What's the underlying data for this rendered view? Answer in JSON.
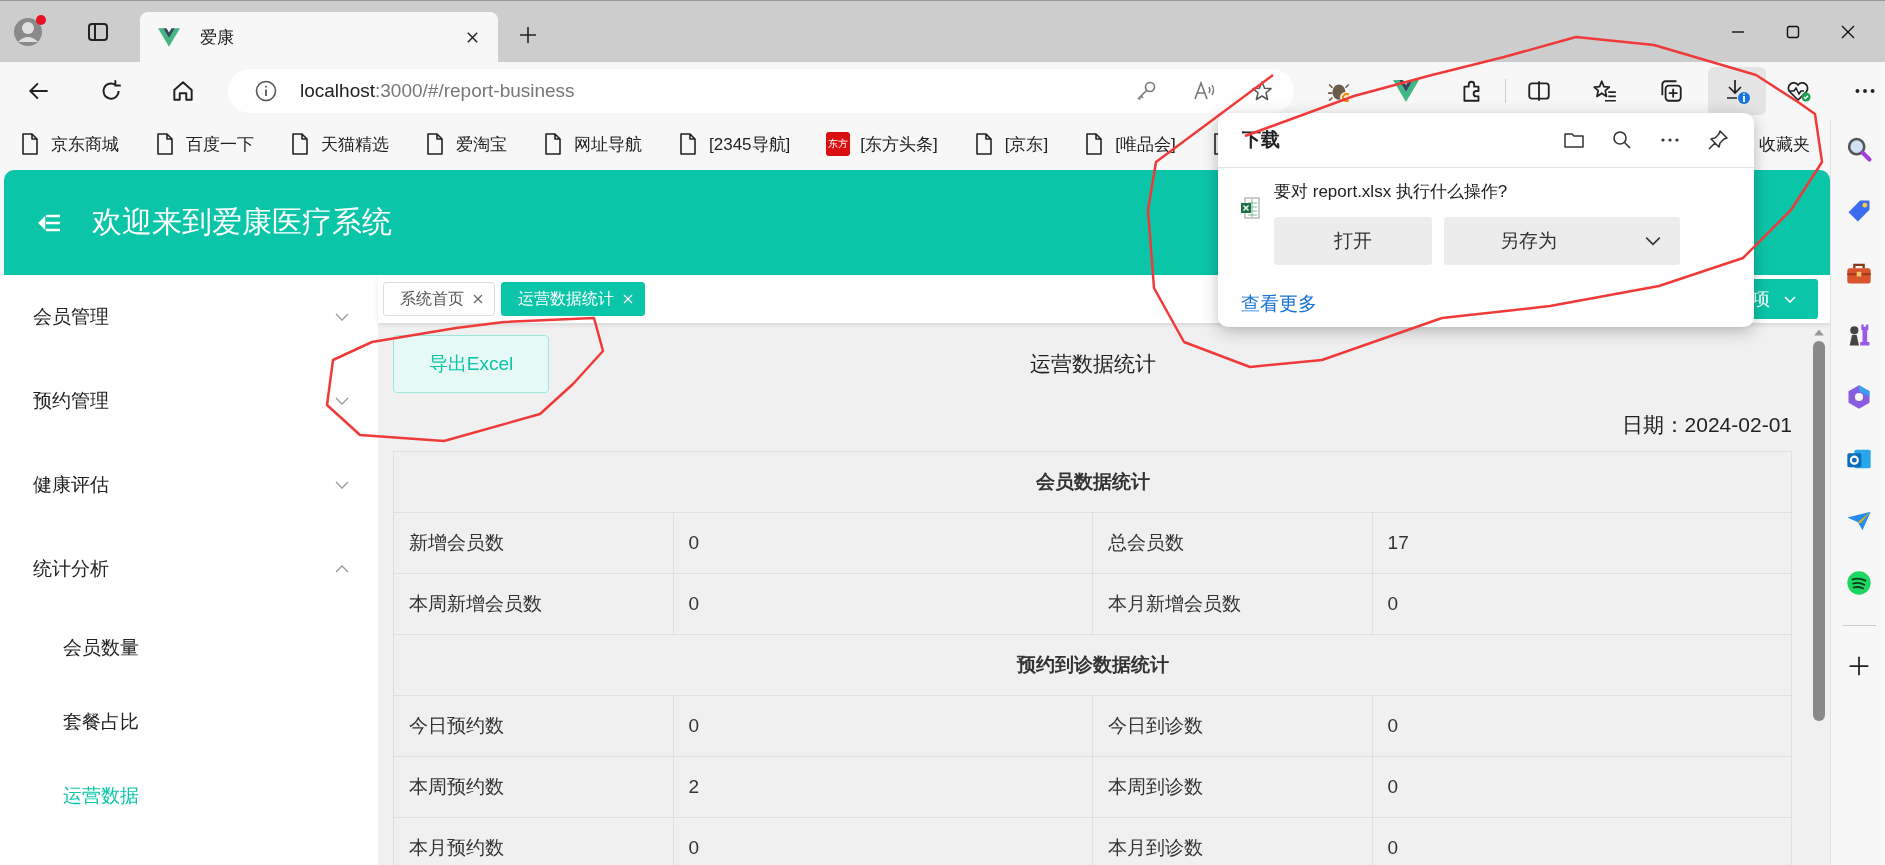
{
  "browser": {
    "tab_title": "爱康",
    "url_host": "localhost",
    "url_path": ":3000/#/report-business"
  },
  "bookmarks": [
    {
      "label": "京东商城",
      "kind": "page"
    },
    {
      "label": "百度一下",
      "kind": "page"
    },
    {
      "label": "天猫精选",
      "kind": "page"
    },
    {
      "label": "爱淘宝",
      "kind": "page"
    },
    {
      "label": "网址导航",
      "kind": "page"
    },
    {
      "label": "[2345导航]",
      "kind": "page"
    },
    {
      "label": "[东方头条]",
      "kind": "logo",
      "logo_text": "东方"
    },
    {
      "label": "[京东]",
      "kind": "page"
    },
    {
      "label": "[唯品会]",
      "kind": "page"
    }
  ],
  "favorites_folder": "收藏夹",
  "download_popup": {
    "title": "下载",
    "message": "要对 report.xlsx 执行什么操作?",
    "buttons": [
      "打开",
      "另存为"
    ],
    "more_link": "查看更多"
  },
  "app": {
    "title": "欢迎来到爱康医疗系统"
  },
  "sidebar": {
    "items": [
      {
        "label": "会员管理",
        "expanded": false
      },
      {
        "label": "预约管理",
        "expanded": false
      },
      {
        "label": "健康评估",
        "expanded": false
      },
      {
        "label": "统计分析",
        "expanded": true,
        "children": [
          {
            "label": "会员数量",
            "selected": false
          },
          {
            "label": "套餐占比",
            "selected": false
          },
          {
            "label": "运营数据",
            "selected": true
          }
        ]
      }
    ]
  },
  "tabs": [
    {
      "label": "系统首页",
      "selected": false
    },
    {
      "label": "运营数据统计",
      "selected": true
    }
  ],
  "tab_menu_button": "项",
  "export_button": "导出Excel",
  "report_title": "运营数据统计",
  "date": "日期：2024-02-01",
  "table": {
    "sections": [
      {
        "title": "会员数据统计",
        "rows": [
          [
            "新增会员数",
            "0",
            "总会员数",
            "17"
          ],
          [
            "本周新增会员数",
            "0",
            "本月新增会员数",
            "0"
          ]
        ]
      },
      {
        "title": "预约到诊数据统计",
        "rows": [
          [
            "今日预约数",
            "0",
            "今日到诊数",
            "0"
          ],
          [
            "本周预约数",
            "2",
            "本周到诊数",
            "0"
          ],
          [
            "本月预约数",
            "0",
            "本月到诊数",
            "0"
          ]
        ]
      }
    ]
  }
}
